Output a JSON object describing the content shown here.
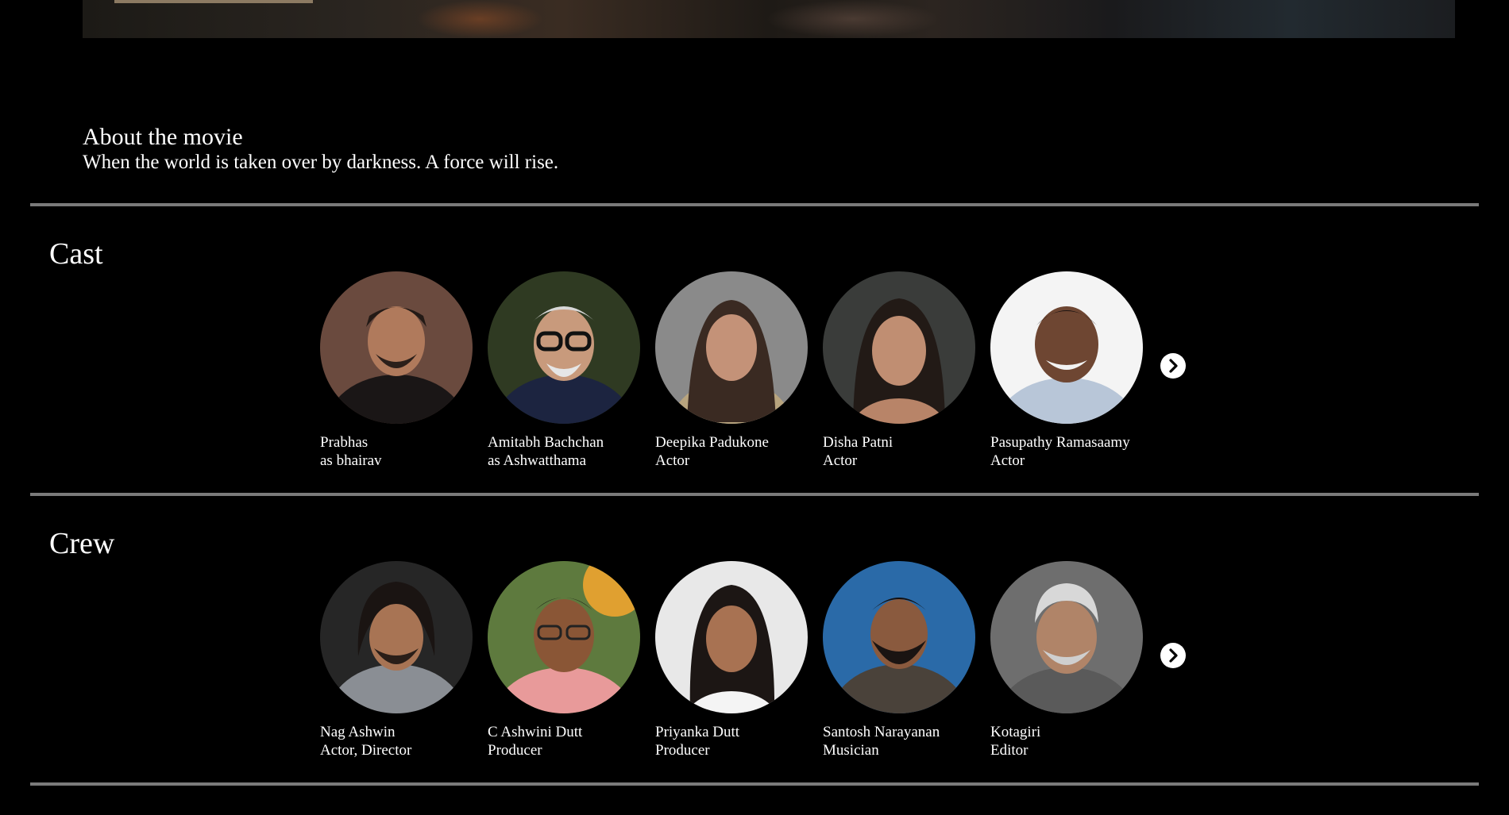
{
  "about": {
    "title": "About the movie",
    "tagline": "When the world is taken over by darkness. A force will rise."
  },
  "cast": {
    "title": "Cast",
    "next_icon": "chevron-right-icon",
    "people": [
      {
        "name": "Prabhas",
        "role": "as bhairav"
      },
      {
        "name": "Amitabh Bachchan",
        "role": "as Ashwatthama"
      },
      {
        "name": "Deepika Padukone",
        "role": "Actor"
      },
      {
        "name": "Disha Patni",
        "role": "Actor"
      },
      {
        "name": "Pasupathy Ramasaamy",
        "role": "Actor"
      }
    ]
  },
  "crew": {
    "title": "Crew",
    "next_icon": "chevron-right-icon",
    "people": [
      {
        "name": "Nag Ashwin",
        "role": "Actor, Director"
      },
      {
        "name": "C Ashwini Dutt",
        "role": "Producer"
      },
      {
        "name": "Priyanka Dutt",
        "role": "Producer"
      },
      {
        "name": "Santosh Narayanan",
        "role": "Musician"
      },
      {
        "name": "Kotagiri",
        "role": "Editor"
      }
    ]
  },
  "colors": {
    "background": "#000000",
    "text": "#ffffff",
    "divider": "#7a7a7a"
  }
}
